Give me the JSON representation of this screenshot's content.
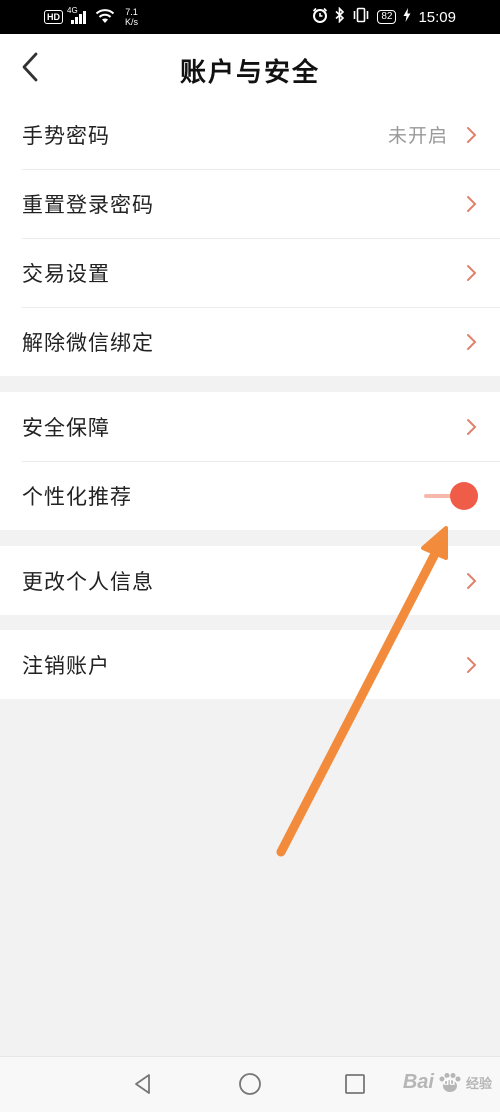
{
  "status_bar": {
    "hd": "HD",
    "signal": "4G",
    "speed_value": "7.1",
    "speed_unit": "K/s",
    "battery": "82",
    "time": "15:09"
  },
  "header": {
    "title": "账户与安全"
  },
  "groups": [
    {
      "items": [
        {
          "label": "手势密码",
          "value": "未开启"
        },
        {
          "label": "重置登录密码"
        },
        {
          "label": "交易设置"
        },
        {
          "label": "解除微信绑定"
        }
      ]
    },
    {
      "items": [
        {
          "label": "安全保障"
        },
        {
          "label": "个性化推荐",
          "toggle_on": true
        }
      ]
    },
    {
      "items": [
        {
          "label": "更改个人信息"
        }
      ]
    },
    {
      "items": [
        {
          "label": "注销账户"
        }
      ]
    }
  ],
  "colors": {
    "accent": "#ef5c48",
    "chevron": "#e0826b",
    "annotation_arrow": "#f28c3c"
  },
  "watermark": {
    "brand": "Bai",
    "paw": "du",
    "sub": "经验"
  }
}
